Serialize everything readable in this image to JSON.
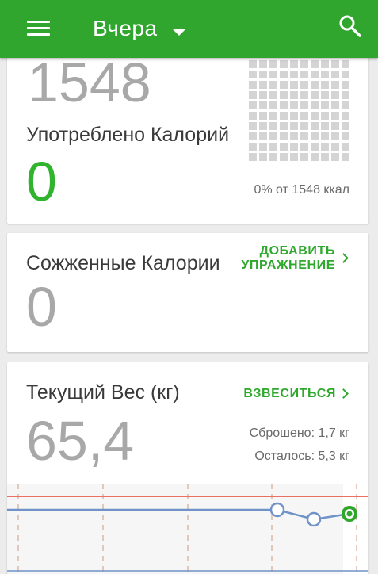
{
  "appbar": {
    "title": "Вчера",
    "menu_icon": "menu-icon",
    "dropdown_icon": "dropdown-arrow-icon",
    "search_icon": "search-icon",
    "color": "#30a62e"
  },
  "calories_card": {
    "goal_value": "1548",
    "consumed_label": "Употреблено Калорий",
    "consumed_value": "0",
    "progress_text": "0% от 1548 ккал",
    "progress_fraction": 0
  },
  "burned_card": {
    "label": "Сожженные Калории",
    "value": "0",
    "add_exercise_line1": "ДОБАВИТЬ",
    "add_exercise_line2": "УПРАЖНЕНИЕ"
  },
  "weight_card": {
    "label": "Текущий Вес (кг)",
    "value": "65,4",
    "weigh_in_label": "ВЗВЕСИТЬСЯ",
    "lost_text": "Сброшено: 1,7 кг",
    "remaining_text": "Осталось: 5,3 кг",
    "chart_colors": {
      "target_line": "#e8715f",
      "weight_line": "#6f93c8",
      "current_point": "#30a62e",
      "gridline": "#d8b8a8"
    }
  }
}
